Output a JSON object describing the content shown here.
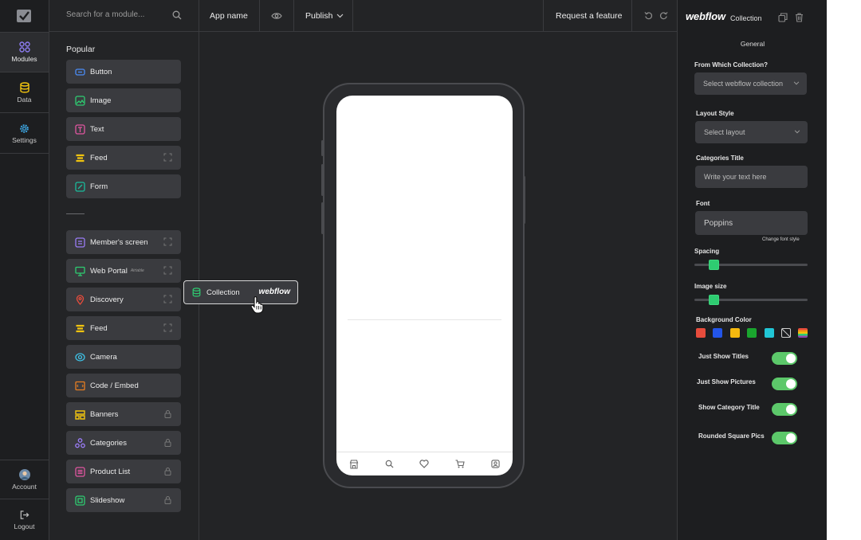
{
  "rail": {
    "items": [
      {
        "label": "Modules",
        "icon": "grid-icon"
      },
      {
        "label": "Data",
        "icon": "database-icon"
      },
      {
        "label": "Settings",
        "icon": "gear-icon"
      }
    ],
    "bottom": [
      {
        "label": "Account",
        "icon": "avatar"
      },
      {
        "label": "Logout",
        "icon": "logout-icon"
      }
    ]
  },
  "modules": {
    "search_placeholder": "Search for a module...",
    "section_title": "Popular",
    "popular": [
      {
        "label": "Button",
        "icon": "button-icon",
        "color": "#4a8cf7"
      },
      {
        "label": "Image",
        "icon": "image-icon",
        "color": "#2ecc71"
      },
      {
        "label": "Text",
        "icon": "text-icon",
        "color": "#e056a0"
      },
      {
        "label": "Feed",
        "icon": "feed-icon",
        "color": "#f1c40f",
        "right": "expand-icon"
      },
      {
        "label": "Form",
        "icon": "form-icon",
        "color": "#1abc9c"
      }
    ],
    "more": [
      {
        "label": "Member's screen",
        "icon": "member-icon",
        "color": "#9b7cf7",
        "right": "expand-icon"
      },
      {
        "label": "Web Portal",
        "icon": "monitor-icon",
        "color": "#2ecc71",
        "right": "expand-icon",
        "badge": "Airtable"
      },
      {
        "label": "Discovery",
        "icon": "pin-icon",
        "color": "#e74c3c",
        "right": "expand-icon"
      },
      {
        "label": "Feed",
        "icon": "feed-icon",
        "color": "#f1c40f",
        "right": "expand-icon"
      },
      {
        "label": "Camera",
        "icon": "camera-icon",
        "color": "#3ec1e6"
      },
      {
        "label": "Code / Embed",
        "icon": "code-icon",
        "color": "#e67e22"
      },
      {
        "label": "Banners",
        "icon": "banner-icon",
        "color": "#f1c40f",
        "right": "lock-icon"
      },
      {
        "label": "Categories",
        "icon": "categories-icon",
        "color": "#9b7cf7",
        "right": "lock-icon"
      },
      {
        "label": "Product List",
        "icon": "list-icon",
        "color": "#e056a0",
        "right": "lock-icon"
      },
      {
        "label": "Slideshow",
        "icon": "slideshow-icon",
        "color": "#2ecc71",
        "right": "lock-icon"
      }
    ]
  },
  "topbar": {
    "app_name": "App name",
    "publish": "Publish",
    "request": "Request a feature"
  },
  "drag": {
    "label": "Collection",
    "brand": "webflow"
  },
  "props": {
    "brand": "webflow",
    "brand_sub": "Collection",
    "tab": "General",
    "collection_label": "From Which Collection?",
    "collection_value": "Select webflow collection",
    "layout_label": "Layout Style",
    "layout_value": "Select layout",
    "categories_label": "Categories Title",
    "categories_placeholder": "Write your text here",
    "font_label": "Font",
    "font_value": "Poppins",
    "change_font": "Change font style",
    "spacing_label": "Spacing",
    "spacing_value": 0.17,
    "image_size_label": "Image size",
    "image_size_value": 0.17,
    "bg_label": "Background Color",
    "swatches": [
      "#e74c3c",
      "#2355e8",
      "#f5b90f",
      "#1aa52e",
      "#21c6d6",
      "none",
      "rainbow"
    ],
    "toggles": [
      {
        "label": "Just Show Titles",
        "on": true
      },
      {
        "label": "Just Show Pictures",
        "on": true
      },
      {
        "label": "Show Category Title",
        "on": true
      },
      {
        "label": "Rounded Square Pics",
        "on": true
      }
    ]
  }
}
